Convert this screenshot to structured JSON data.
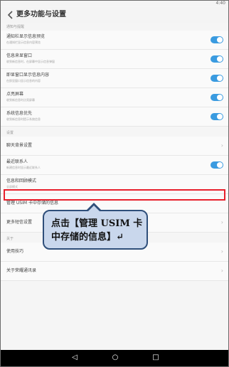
{
  "status": {
    "time": "4:40"
  },
  "header": {
    "title": "更多功能与设置"
  },
  "sections": [
    {
      "title": "通知与提醒",
      "items": [
        {
          "label": "通知栏显示信息预览",
          "desc": "在通知栏显示信息内容预览",
          "control": "toggle",
          "on": true
        },
        {
          "label": "信息来显窗口",
          "desc": "收到新信息时，在屏幕中显示信息弹窗",
          "control": "toggle",
          "on": true
        },
        {
          "label": "即显窗口显示信息内容",
          "desc": "在即显窗口显示信息的内容",
          "control": "toggle",
          "on": true
        },
        {
          "label": "点亮屏幕",
          "desc": "收到新信息时点亮屏幕",
          "control": "toggle",
          "on": true
        },
        {
          "label": "系统信息优先",
          "desc": "收到新信息时提示系统信息",
          "control": "toggle",
          "on": true
        }
      ]
    },
    {
      "title": "设置",
      "items": [
        {
          "label": "聊天背景设置",
          "control": "chevron"
        },
        {
          "label": "最近联系人",
          "desc": "新建信息时显示最近联系人",
          "control": "toggle",
          "on": true
        },
        {
          "label": "信息和回顾模式",
          "desc": "全部模式",
          "control": "none"
        },
        {
          "label": "管理 USIM 卡中存储的信息",
          "control": "none"
        },
        {
          "label": "更多短信设置",
          "control": "chevron"
        }
      ]
    },
    {
      "title": "关于",
      "items": [
        {
          "label": "使用技巧",
          "control": "chevron"
        },
        {
          "label": "关于荣耀通讯录",
          "control": "chevron"
        }
      ]
    }
  ],
  "callout": {
    "line1": "点击【管理 USIM 卡",
    "line2": "中存储的信息】↵"
  },
  "colors": {
    "toggle_on": "#3a9be0",
    "highlight": "#e8202c",
    "callout_fill": "#c9d7ec",
    "callout_border": "#2f4f7a"
  },
  "icons": {
    "back": "back-arrow-icon",
    "chevron": "chevron-right-icon",
    "nav_back": "triangle-back-icon",
    "nav_home": "circle-home-icon",
    "nav_recent": "square-recent-icon"
  }
}
